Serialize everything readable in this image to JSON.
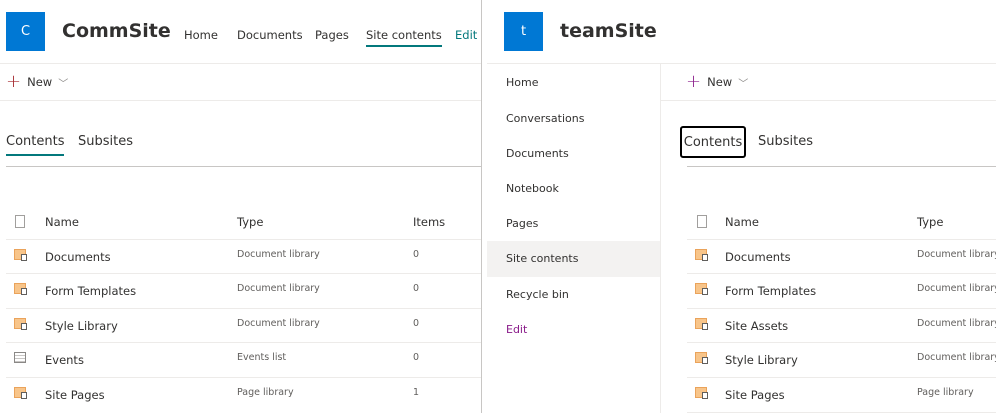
{
  "left": {
    "logo_letter": "C",
    "title": "CommSite",
    "nav": [
      "Home",
      "Documents",
      "Pages",
      "Site contents",
      "Edit"
    ],
    "new_label": "New",
    "tabs": [
      "Contents",
      "Subsites"
    ],
    "columns": [
      "Name",
      "Type",
      "Items"
    ],
    "rows": [
      {
        "name": "Documents",
        "type": "Document library",
        "items": "0",
        "icon": "library-icon"
      },
      {
        "name": "Form Templates",
        "type": "Document library",
        "items": "0",
        "icon": "library-icon"
      },
      {
        "name": "Style Library",
        "type": "Document library",
        "items": "0",
        "icon": "library-icon"
      },
      {
        "name": "Events",
        "type": "Events list",
        "items": "0",
        "icon": "calendar-list-icon"
      },
      {
        "name": "Site Pages",
        "type": "Page library",
        "items": "1",
        "icon": "library-icon"
      }
    ]
  },
  "right": {
    "logo_letter": "t",
    "title": "teamSite",
    "sidebar": [
      "Home",
      "Conversations",
      "Documents",
      "Notebook",
      "Pages",
      "Site contents",
      "Recycle bin",
      "Edit"
    ],
    "new_label": "New",
    "tabs": [
      "Contents",
      "Subsites"
    ],
    "columns": [
      "Name",
      "Type"
    ],
    "rows": [
      {
        "name": "Documents",
        "type": "Document library"
      },
      {
        "name": "Form Templates",
        "type": "Document library"
      },
      {
        "name": "Site Assets",
        "type": "Document library"
      },
      {
        "name": "Style Library",
        "type": "Document library"
      },
      {
        "name": "Site Pages",
        "type": "Page library"
      }
    ]
  },
  "colors": {
    "logo": "#0078d4",
    "accent_left": "#03787c",
    "accent_right": "#8a1b8a",
    "selected_bg": "#f3f2f1"
  }
}
